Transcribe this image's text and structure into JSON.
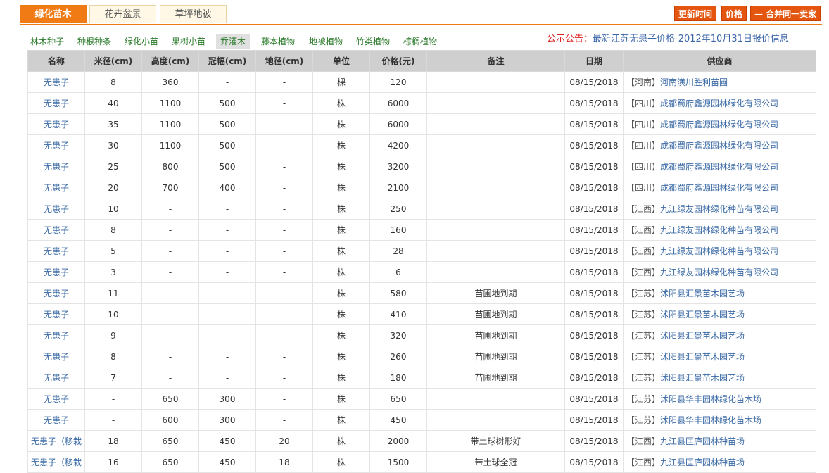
{
  "tabs": [
    "绿化苗木",
    "花卉盆景",
    "草坪地被"
  ],
  "buttons": {
    "update_time": "更新时间",
    "price": "价格",
    "merge": "— 合并同一卖家"
  },
  "subnav": [
    "林木种子",
    "种根种条",
    "绿化小苗",
    "果树小苗",
    "乔灌木",
    "藤本植物",
    "地被植物",
    "竹类植物",
    "棕榈植物"
  ],
  "notice": {
    "lead": "公示公告：",
    "text": "最新江苏无患子价格-2012年10月31日报价信息"
  },
  "headers": [
    "名称",
    "米径(cm)",
    "高度(cm)",
    "冠幅(cm)",
    "地径(cm)",
    "单位",
    "价格(元)",
    "备注",
    "日期",
    "供应商"
  ],
  "rows": [
    {
      "name": "无患子",
      "mj": "8",
      "gd": "360",
      "gf": "-",
      "dj": "-",
      "unit": "棵",
      "price": "120",
      "note": "",
      "date": "08/15/2018",
      "region": "【河南】",
      "supplier": "河南潢川胜利苗圃"
    },
    {
      "name": "无患子",
      "mj": "40",
      "gd": "1100",
      "gf": "500",
      "dj": "-",
      "unit": "株",
      "price": "6000",
      "note": "",
      "date": "08/15/2018",
      "region": "【四川】",
      "supplier": "成都蜀府鑫源园林绿化有限公司"
    },
    {
      "name": "无患子",
      "mj": "35",
      "gd": "1100",
      "gf": "500",
      "dj": "-",
      "unit": "株",
      "price": "6000",
      "note": "",
      "date": "08/15/2018",
      "region": "【四川】",
      "supplier": "成都蜀府鑫源园林绿化有限公司"
    },
    {
      "name": "无患子",
      "mj": "30",
      "gd": "1100",
      "gf": "500",
      "dj": "-",
      "unit": "株",
      "price": "4200",
      "note": "",
      "date": "08/15/2018",
      "region": "【四川】",
      "supplier": "成都蜀府鑫源园林绿化有限公司"
    },
    {
      "name": "无患子",
      "mj": "25",
      "gd": "800",
      "gf": "500",
      "dj": "-",
      "unit": "株",
      "price": "3200",
      "note": "",
      "date": "08/15/2018",
      "region": "【四川】",
      "supplier": "成都蜀府鑫源园林绿化有限公司"
    },
    {
      "name": "无患子",
      "mj": "20",
      "gd": "700",
      "gf": "400",
      "dj": "-",
      "unit": "株",
      "price": "2100",
      "note": "",
      "date": "08/15/2018",
      "region": "【四川】",
      "supplier": "成都蜀府鑫源园林绿化有限公司"
    },
    {
      "name": "无患子",
      "mj": "10",
      "gd": "-",
      "gf": "-",
      "dj": "-",
      "unit": "株",
      "price": "250",
      "note": "",
      "date": "08/15/2018",
      "region": "【江西】",
      "supplier": "九江绿友园林绿化种苗有限公司"
    },
    {
      "name": "无患子",
      "mj": "8",
      "gd": "-",
      "gf": "-",
      "dj": "-",
      "unit": "株",
      "price": "160",
      "note": "",
      "date": "08/15/2018",
      "region": "【江西】",
      "supplier": "九江绿友园林绿化种苗有限公司"
    },
    {
      "name": "无患子",
      "mj": "5",
      "gd": "-",
      "gf": "-",
      "dj": "-",
      "unit": "株",
      "price": "28",
      "note": "",
      "date": "08/15/2018",
      "region": "【江西】",
      "supplier": "九江绿友园林绿化种苗有限公司"
    },
    {
      "name": "无患子",
      "mj": "3",
      "gd": "-",
      "gf": "-",
      "dj": "-",
      "unit": "株",
      "price": "6",
      "note": "",
      "date": "08/15/2018",
      "region": "【江西】",
      "supplier": "九江绿友园林绿化种苗有限公司"
    },
    {
      "name": "无患子",
      "mj": "11",
      "gd": "-",
      "gf": "-",
      "dj": "-",
      "unit": "株",
      "price": "580",
      "note": "苗圃地到期",
      "date": "08/15/2018",
      "region": "【江苏】",
      "supplier": "沭阳县汇景苗木园艺场"
    },
    {
      "name": "无患子",
      "mj": "10",
      "gd": "-",
      "gf": "-",
      "dj": "-",
      "unit": "株",
      "price": "410",
      "note": "苗圃地到期",
      "date": "08/15/2018",
      "region": "【江苏】",
      "supplier": "沭阳县汇景苗木园艺场"
    },
    {
      "name": "无患子",
      "mj": "9",
      "gd": "-",
      "gf": "-",
      "dj": "-",
      "unit": "株",
      "price": "320",
      "note": "苗圃地到期",
      "date": "08/15/2018",
      "region": "【江苏】",
      "supplier": "沭阳县汇景苗木园艺场"
    },
    {
      "name": "无患子",
      "mj": "8",
      "gd": "-",
      "gf": "-",
      "dj": "-",
      "unit": "株",
      "price": "260",
      "note": "苗圃地到期",
      "date": "08/15/2018",
      "region": "【江苏】",
      "supplier": "沭阳县汇景苗木园艺场"
    },
    {
      "name": "无患子",
      "mj": "7",
      "gd": "-",
      "gf": "-",
      "dj": "-",
      "unit": "株",
      "price": "180",
      "note": "苗圃地到期",
      "date": "08/15/2018",
      "region": "【江苏】",
      "supplier": "沭阳县汇景苗木园艺场"
    },
    {
      "name": "无患子",
      "mj": "-",
      "gd": "650",
      "gf": "300",
      "dj": "-",
      "unit": "株",
      "price": "650",
      "note": "",
      "date": "08/15/2018",
      "region": "【江苏】",
      "supplier": "沭阳县华丰园林绿化苗木场"
    },
    {
      "name": "无患子",
      "mj": "-",
      "gd": "600",
      "gf": "300",
      "dj": "-",
      "unit": "株",
      "price": "450",
      "note": "",
      "date": "08/15/2018",
      "region": "【江苏】",
      "supplier": "沭阳县华丰园林绿化苗木场"
    },
    {
      "name": "无患子（移栽",
      "mj": "18",
      "gd": "650",
      "gf": "450",
      "dj": "20",
      "unit": "株",
      "price": "2000",
      "note": "带土球树形好",
      "date": "08/15/2018",
      "region": "【江西】",
      "supplier": "九江县匡庐园林种苗场"
    },
    {
      "name": "无患子（移栽",
      "mj": "16",
      "gd": "650",
      "gf": "450",
      "dj": "18",
      "unit": "株",
      "price": "1500",
      "note": "带土球全冠",
      "date": "08/15/2018",
      "region": "【江西】",
      "supplier": "九江县匡庐园林种苗场"
    }
  ]
}
